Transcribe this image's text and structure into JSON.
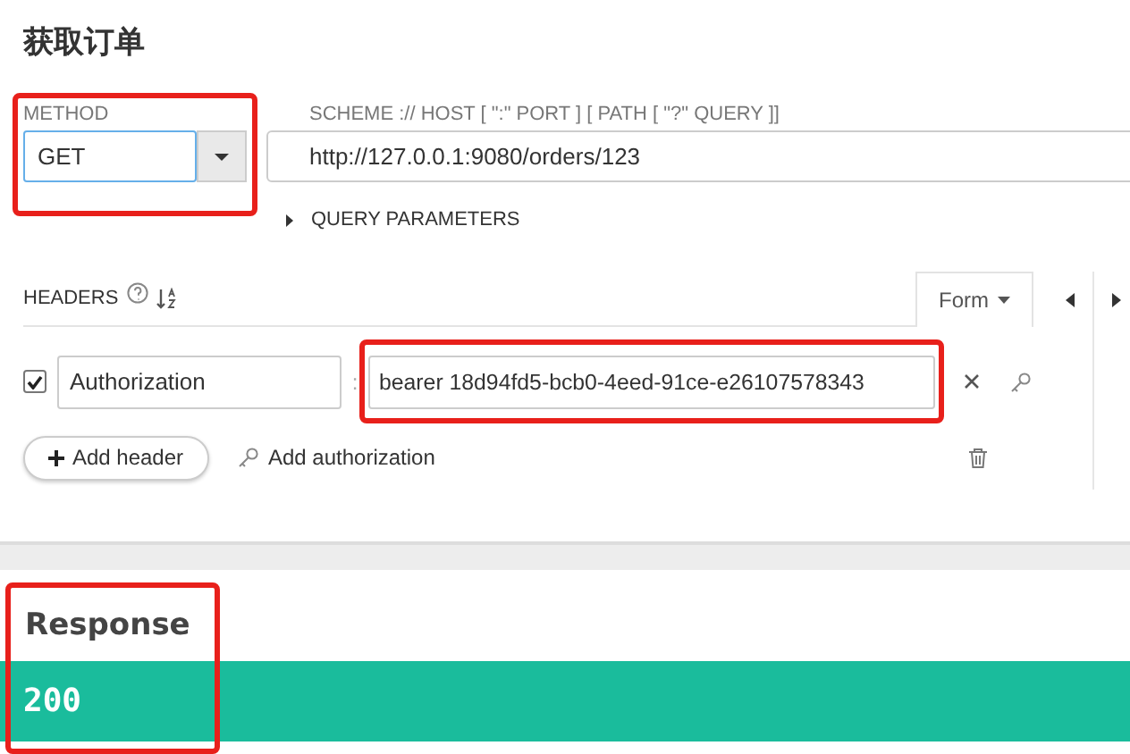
{
  "title": "获取订单",
  "method": {
    "label": "METHOD",
    "value": "GET",
    "highlighted": true
  },
  "url": {
    "label": "SCHEME :// HOST [ \":\" PORT ] [ PATH [ \"?\" QUERY ]]",
    "value": "http://127.0.0.1:9080/orders/123"
  },
  "query_parameters": {
    "label": "QUERY PARAMETERS",
    "expanded": false
  },
  "headers": {
    "label": "HEADERS",
    "mode": "Form",
    "rows": [
      {
        "checked": true,
        "name": "Authorization",
        "separator": ":",
        "value": "bearer 18d94fd5-bcb0-4eed-91ce-e26107578343",
        "highlighted": true
      }
    ],
    "add_header": "Add header",
    "add_authorization": "Add authorization"
  },
  "response": {
    "title": "Response",
    "status": "200",
    "highlighted": true
  }
}
